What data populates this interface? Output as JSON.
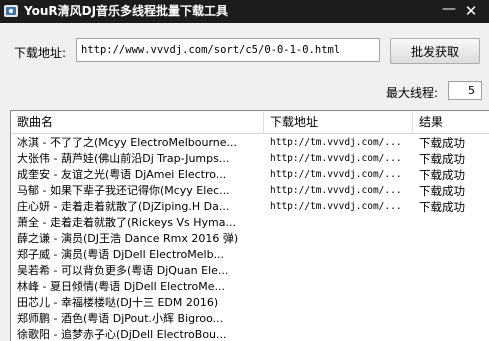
{
  "window": {
    "title": "YouR清风DJ音乐多线程批量下载工具",
    "minimize_glyph": "—",
    "close_glyph": "✕"
  },
  "form": {
    "url_label": "下载地址:",
    "url_value": "http://www.vvvdj.com/sort/c5/0-0-1-0.html",
    "fetch_button": "批发获取",
    "threads_label": "最大线程:",
    "threads_value": "5"
  },
  "table": {
    "columns": [
      "歌曲名",
      "下载地址",
      "结果"
    ],
    "rows": [
      {
        "name": "冰淇 - 不了了之(Mcyy ElectroMelbourne...",
        "url": "http://tm.vvvdj.com/...",
        "result": "下载成功"
      },
      {
        "name": "大张伟 - 葫芦娃(佛山前沿Dj Trap-Jumps...",
        "url": "http://tm.vvvdj.com/...",
        "result": "下载成功"
      },
      {
        "name": "成奎安 - 友谊之光(粤语 DjAmei Electro...",
        "url": "http://tm.vvvdj.com/...",
        "result": "下载成功"
      },
      {
        "name": "马郁 - 如果下辈子我还记得你(Mcyy Elec...",
        "url": "http://tm.vvvdj.com/...",
        "result": "下载成功"
      },
      {
        "name": "庄心妍 - 走着走着就散了(DjZiping.H Da...",
        "url": "http://tm.vvvdj.com/...",
        "result": "下载成功"
      },
      {
        "name": "萧全 - 走着走着就散了(Rickeys Vs Hyma...",
        "url": "",
        "result": ""
      },
      {
        "name": "薛之谦 - 演员(DJ王浩 Dance Rmx 2016 弹)",
        "url": "",
        "result": ""
      },
      {
        "name": "郑子威 - 演员(粤语 DjDell ElectroMelb...",
        "url": "",
        "result": ""
      },
      {
        "name": "吴若希 - 可以背负更多(粤语 DjQuan Ele...",
        "url": "",
        "result": ""
      },
      {
        "name": "林峰 - 夏日倾情(粤语 DjDell ElectroMe...",
        "url": "",
        "result": ""
      },
      {
        "name": "田芯儿 - 幸福楼楼哒(DJ十三 EDM 2016)",
        "url": "",
        "result": ""
      },
      {
        "name": "郑师鹏 - 酒色(粤语 DjPout.小辉 Bigroo...",
        "url": "",
        "result": ""
      },
      {
        "name": "徐歌阳 - 追梦赤子心(DjDell ElectroBou...",
        "url": "",
        "result": ""
      }
    ]
  }
}
